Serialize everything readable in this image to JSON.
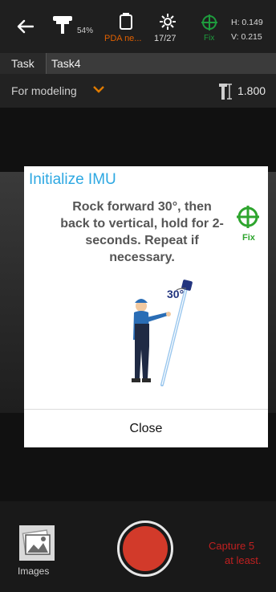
{
  "status": {
    "back_icon": "arrow-left-icon",
    "gnss_icon": "gnss-receiver-icon",
    "battery": "54%",
    "pda_label": "PDA ne...",
    "satellites": "17/27",
    "fix_label": "Fix",
    "h_label": "H: 0.149",
    "v_label": "V: 0.215"
  },
  "task": {
    "label": "Task",
    "value": "Task4"
  },
  "mode": {
    "label": "For modeling",
    "pole_height": "1.800"
  },
  "dialog": {
    "title": "Initialize IMU",
    "message": "Rock forward 30°, then back to vertical, hold for 2-seconds. Repeat if necessary.",
    "fix_label": "Fix",
    "angle_label": "30°",
    "close_label": "Close"
  },
  "bottom": {
    "images_label": "Images",
    "capture_note_line1": "Capture 5",
    "capture_note_line2": "at least."
  },
  "colors": {
    "title_blue": "#2ea8e2",
    "fix_green": "#2ea52e",
    "pda_orange": "#e06000",
    "shutter_red": "#d23a2a"
  }
}
